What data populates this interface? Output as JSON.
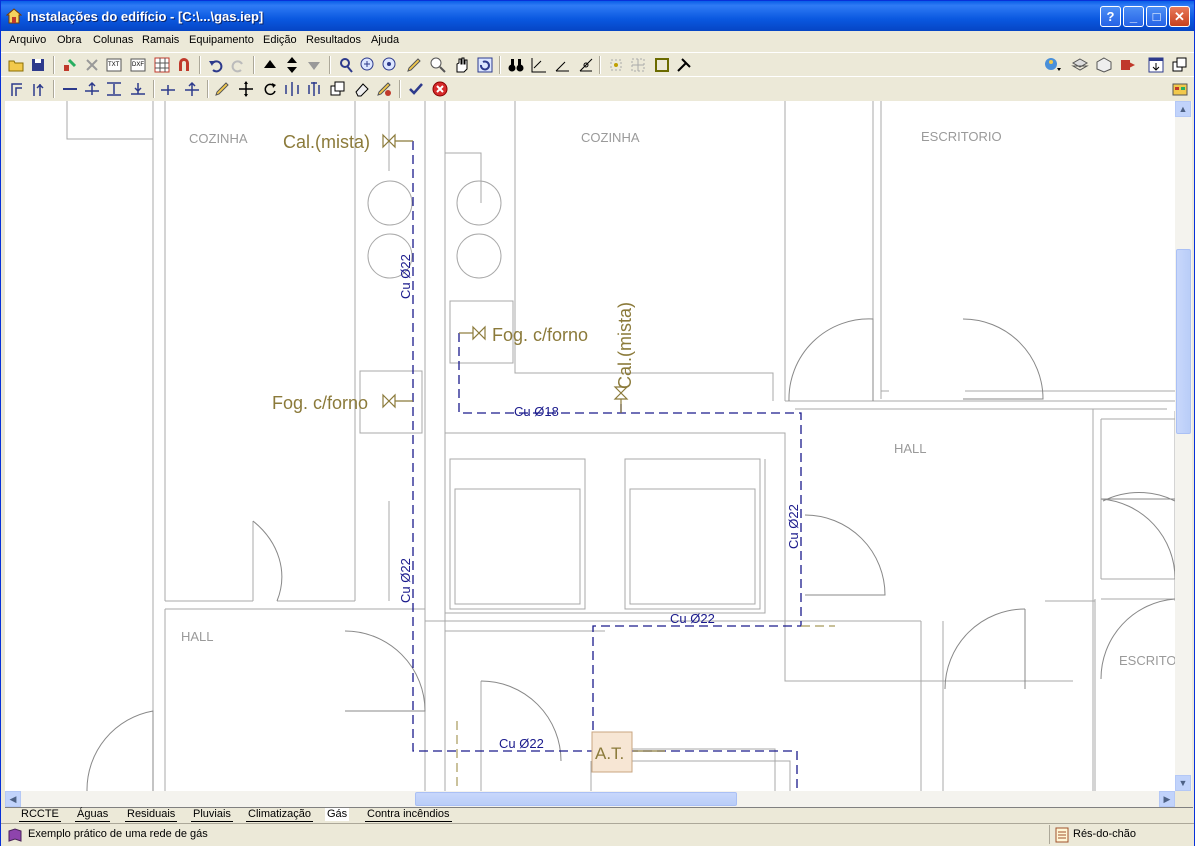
{
  "window": {
    "title": "Instalações do edifício - [C:\\...\\gas.iep]"
  },
  "title_buttons": {
    "help": "?",
    "minimize": "_",
    "maximize": "□",
    "close": "✕"
  },
  "menu": [
    "Arquivo",
    "Obra",
    "Colunas",
    "Ramais",
    "Equipamento",
    "Edição",
    "Resultados",
    "Ajuda"
  ],
  "drawing": {
    "rooms": [
      "COZINHA",
      "COZINHA",
      "ESCRITORIO",
      "HALL",
      "HALL",
      "ESCRITO"
    ],
    "labels": {
      "cal_mista_1": "Cal.(mista)",
      "fog_forno_1": "Fog. c/forno",
      "fog_forno_2": "Fog. c/forno",
      "cal_mista_2": "Cal.(mista)",
      "at": "A.T."
    },
    "pipes": [
      "Cu Ø22",
      "Cu Ø22",
      "Cu Ø18",
      "Cu Ø22",
      "Cu Ø22",
      "Cu Ø22"
    ]
  },
  "tabs": [
    "RCCTE",
    "Águas",
    "Residuais",
    "Pluviais",
    "Climatização",
    "Gás",
    "Contra incêndios"
  ],
  "active_tab": "Gás",
  "status": {
    "message": "Exemplo prático de uma rede de gás",
    "floor": "Rés-do-chão"
  },
  "colors": {
    "pipe": "#1a1a8c",
    "equipment": "#8b7a3a",
    "walls": "#a0a0a0",
    "title": "#0a58e0"
  }
}
